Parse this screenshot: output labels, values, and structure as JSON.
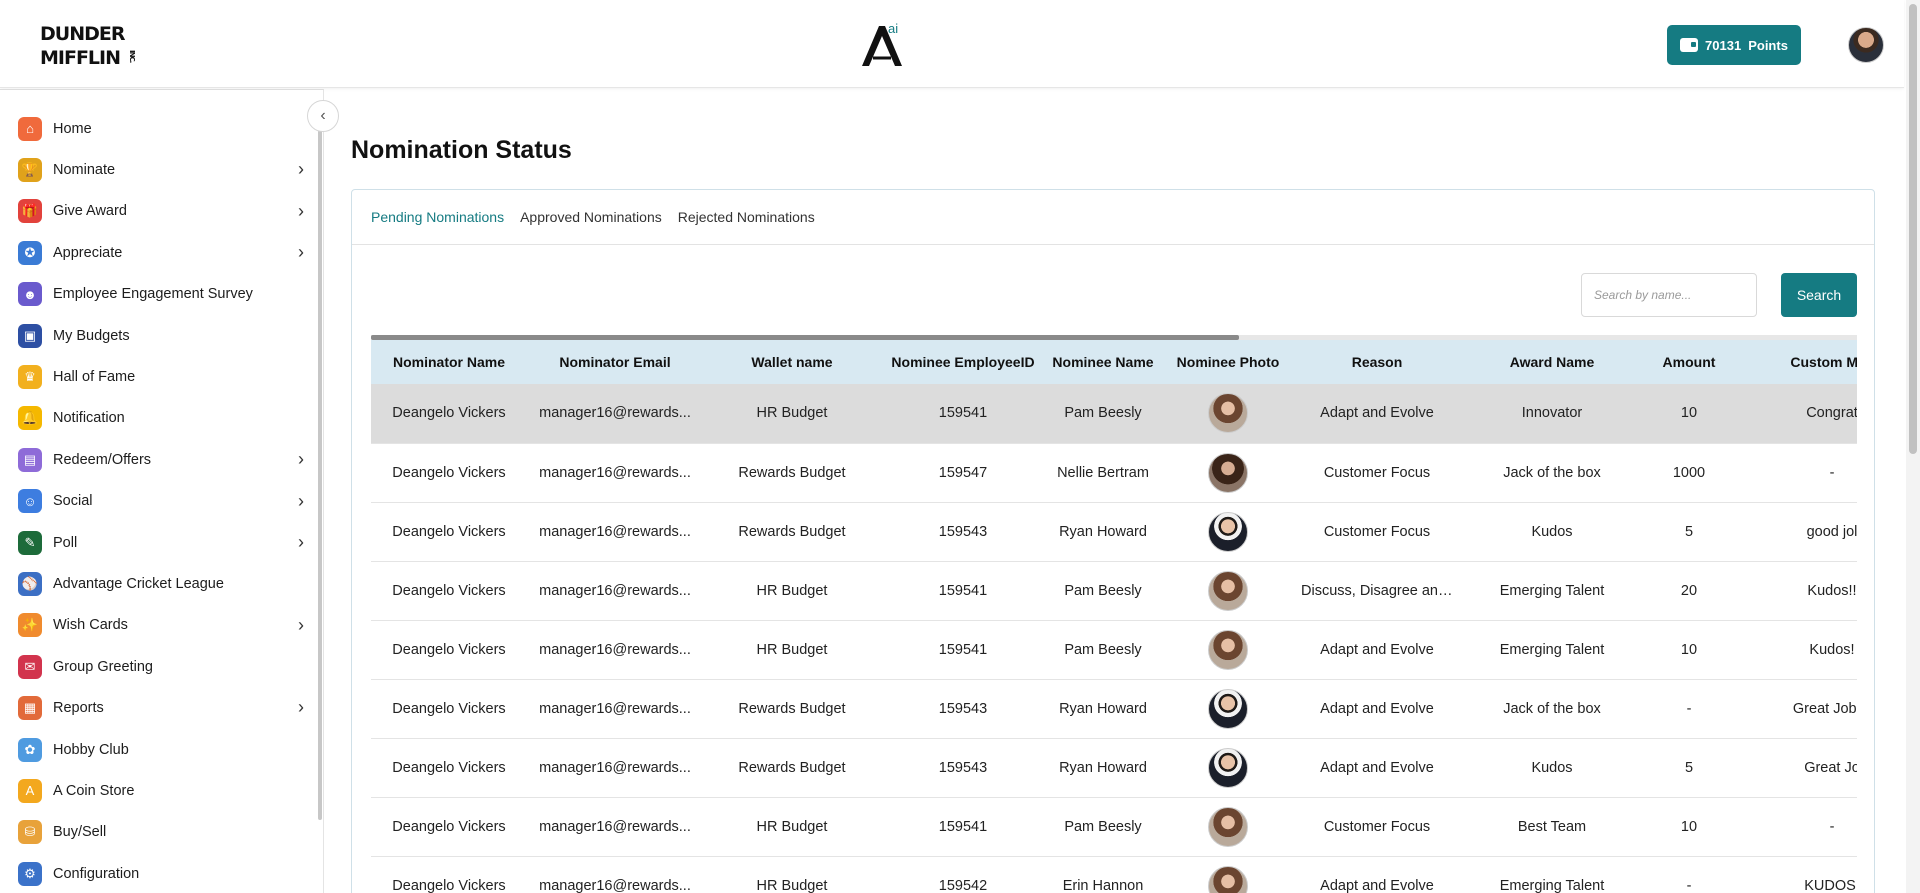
{
  "header": {
    "logo_text": "DUNDER MIFFLIN INC.",
    "brand_mark": "A",
    "brand_mark_sup": "ai",
    "points_value": "70131",
    "points_label": "Points"
  },
  "sidebar": {
    "items": [
      {
        "label": "Home",
        "icon": "home-icon",
        "color": "#f06a3c",
        "glyph": "⌂",
        "submenu": false
      },
      {
        "label": "Nominate",
        "icon": "trophy-icon",
        "color": "#e0a21b",
        "glyph": "🏆",
        "submenu": true
      },
      {
        "label": "Give Award",
        "icon": "gift-icon",
        "color": "#e2423c",
        "glyph": "🎁",
        "submenu": true
      },
      {
        "label": "Appreciate",
        "icon": "medal-icon",
        "color": "#3a7bd5",
        "glyph": "✪",
        "submenu": true
      },
      {
        "label": "Employee Engagement Survey",
        "icon": "survey-icon",
        "color": "#6a5acd",
        "glyph": "☻",
        "submenu": false
      },
      {
        "label": "My Budgets",
        "icon": "wallet-icon",
        "color": "#2d4fa3",
        "glyph": "▣",
        "submenu": false
      },
      {
        "label": "Hall of Fame",
        "icon": "crown-icon",
        "color": "#f2b01e",
        "glyph": "♛",
        "submenu": false
      },
      {
        "label": "Notification",
        "icon": "bell-icon",
        "color": "#f5b800",
        "glyph": "🔔",
        "submenu": false
      },
      {
        "label": "Redeem/Offers",
        "icon": "voucher-icon",
        "color": "#8e6bd8",
        "glyph": "▤",
        "submenu": true
      },
      {
        "label": "Social",
        "icon": "social-icon",
        "color": "#3d7de0",
        "glyph": "☺",
        "submenu": true
      },
      {
        "label": "Poll",
        "icon": "poll-icon",
        "color": "#1d6b3a",
        "glyph": "✎",
        "submenu": true
      },
      {
        "label": "Advantage Cricket League",
        "icon": "cricket-icon",
        "color": "#3c6fc4",
        "glyph": "⚾",
        "submenu": false
      },
      {
        "label": "Wish Cards",
        "icon": "party-icon",
        "color": "#f08b2e",
        "glyph": "✨",
        "submenu": true
      },
      {
        "label": "Group Greeting",
        "icon": "envelope-icon",
        "color": "#d2344d",
        "glyph": "✉",
        "submenu": false
      },
      {
        "label": "Reports",
        "icon": "clipboard-icon",
        "color": "#e26a3a",
        "glyph": "▦",
        "submenu": true
      },
      {
        "label": "Hobby Club",
        "icon": "palette-icon",
        "color": "#4f9be0",
        "glyph": "✿",
        "submenu": false
      },
      {
        "label": "A Coin Store",
        "icon": "coin-icon",
        "color": "#f3a81e",
        "glyph": "A",
        "submenu": false
      },
      {
        "label": "Buy/Sell",
        "icon": "shopping-bag-icon",
        "color": "#e8a23a",
        "glyph": "⛁",
        "submenu": false
      },
      {
        "label": "Configuration",
        "icon": "settings-icon",
        "color": "#3b72c9",
        "glyph": "⚙",
        "submenu": false
      }
    ]
  },
  "main": {
    "page_title": "Nomination Status",
    "tabs": [
      {
        "label": "Pending Nominations",
        "active": true
      },
      {
        "label": "Approved Nominations",
        "active": false
      },
      {
        "label": "Rejected Nominations",
        "active": false
      }
    ],
    "search": {
      "placeholder": "Search by name...",
      "value": "",
      "button_label": "Search"
    },
    "table": {
      "columns": [
        "Nominator Name",
        "Nominator Email",
        "Wallet name",
        "Nominee EmployeeID",
        "Nominee Name",
        "Nominee Photo",
        "Reason",
        "Award Name",
        "Amount",
        "Custom Mes"
      ],
      "rows": [
        {
          "nominator": "Deangelo Vickers",
          "email": "manager16@rewards...",
          "wallet": "HR Budget",
          "employee_id": "159541",
          "nominee": "Pam Beesly",
          "photo": "photo-female",
          "reason": "Adapt and Evolve",
          "award": "Innovator",
          "amount": "10",
          "message": "Congrat",
          "selected": true
        },
        {
          "nominator": "Deangelo Vickers",
          "email": "manager16@rewards...",
          "wallet": "Rewards Budget",
          "employee_id": "159547",
          "nominee": "Nellie Bertram",
          "photo": "photo-female-dark",
          "reason": "Customer Focus",
          "award": "Jack of the box",
          "amount": "1000",
          "message": "-",
          "selected": false
        },
        {
          "nominator": "Deangelo Vickers",
          "email": "manager16@rewards...",
          "wallet": "Rewards Budget",
          "employee_id": "159543",
          "nominee": "Ryan Howard",
          "photo": "photo-male",
          "reason": "Customer Focus",
          "award": "Kudos",
          "amount": "5",
          "message": "good jol",
          "selected": false
        },
        {
          "nominator": "Deangelo Vickers",
          "email": "manager16@rewards...",
          "wallet": "HR Budget",
          "employee_id": "159541",
          "nominee": "Pam Beesly",
          "photo": "photo-female",
          "reason": "Discuss, Disagree and...",
          "award": "Emerging Talent",
          "amount": "20",
          "message": "Kudos!!",
          "selected": false
        },
        {
          "nominator": "Deangelo Vickers",
          "email": "manager16@rewards...",
          "wallet": "HR Budget",
          "employee_id": "159541",
          "nominee": "Pam Beesly",
          "photo": "photo-female",
          "reason": "Adapt and Evolve",
          "award": "Emerging Talent",
          "amount": "10",
          "message": "Kudos!",
          "selected": false
        },
        {
          "nominator": "Deangelo Vickers",
          "email": "manager16@rewards...",
          "wallet": "Rewards Budget",
          "employee_id": "159543",
          "nominee": "Ryan Howard",
          "photo": "photo-male",
          "reason": "Adapt and Evolve",
          "award": "Jack of the box",
          "amount": "-",
          "message": "Great Job D",
          "selected": false
        },
        {
          "nominator": "Deangelo Vickers",
          "email": "manager16@rewards...",
          "wallet": "Rewards Budget",
          "employee_id": "159543",
          "nominee": "Ryan Howard",
          "photo": "photo-male",
          "reason": "Adapt and Evolve",
          "award": "Kudos",
          "amount": "5",
          "message": "Great Jo",
          "selected": false
        },
        {
          "nominator": "Deangelo Vickers",
          "email": "manager16@rewards...",
          "wallet": "HR Budget",
          "employee_id": "159541",
          "nominee": "Pam Beesly",
          "photo": "photo-female",
          "reason": "Customer Focus",
          "award": "Best Team",
          "amount": "10",
          "message": "-",
          "selected": false
        },
        {
          "nominator": "Deangelo Vickers",
          "email": "manager16@rewards...",
          "wallet": "HR Budget",
          "employee_id": "159542",
          "nominee": "Erin Hannon",
          "photo": "photo-female",
          "reason": "Adapt and Evolve",
          "award": "Emerging Talent",
          "amount": "-",
          "message": "KUDOS!",
          "selected": false
        }
      ]
    }
  }
}
